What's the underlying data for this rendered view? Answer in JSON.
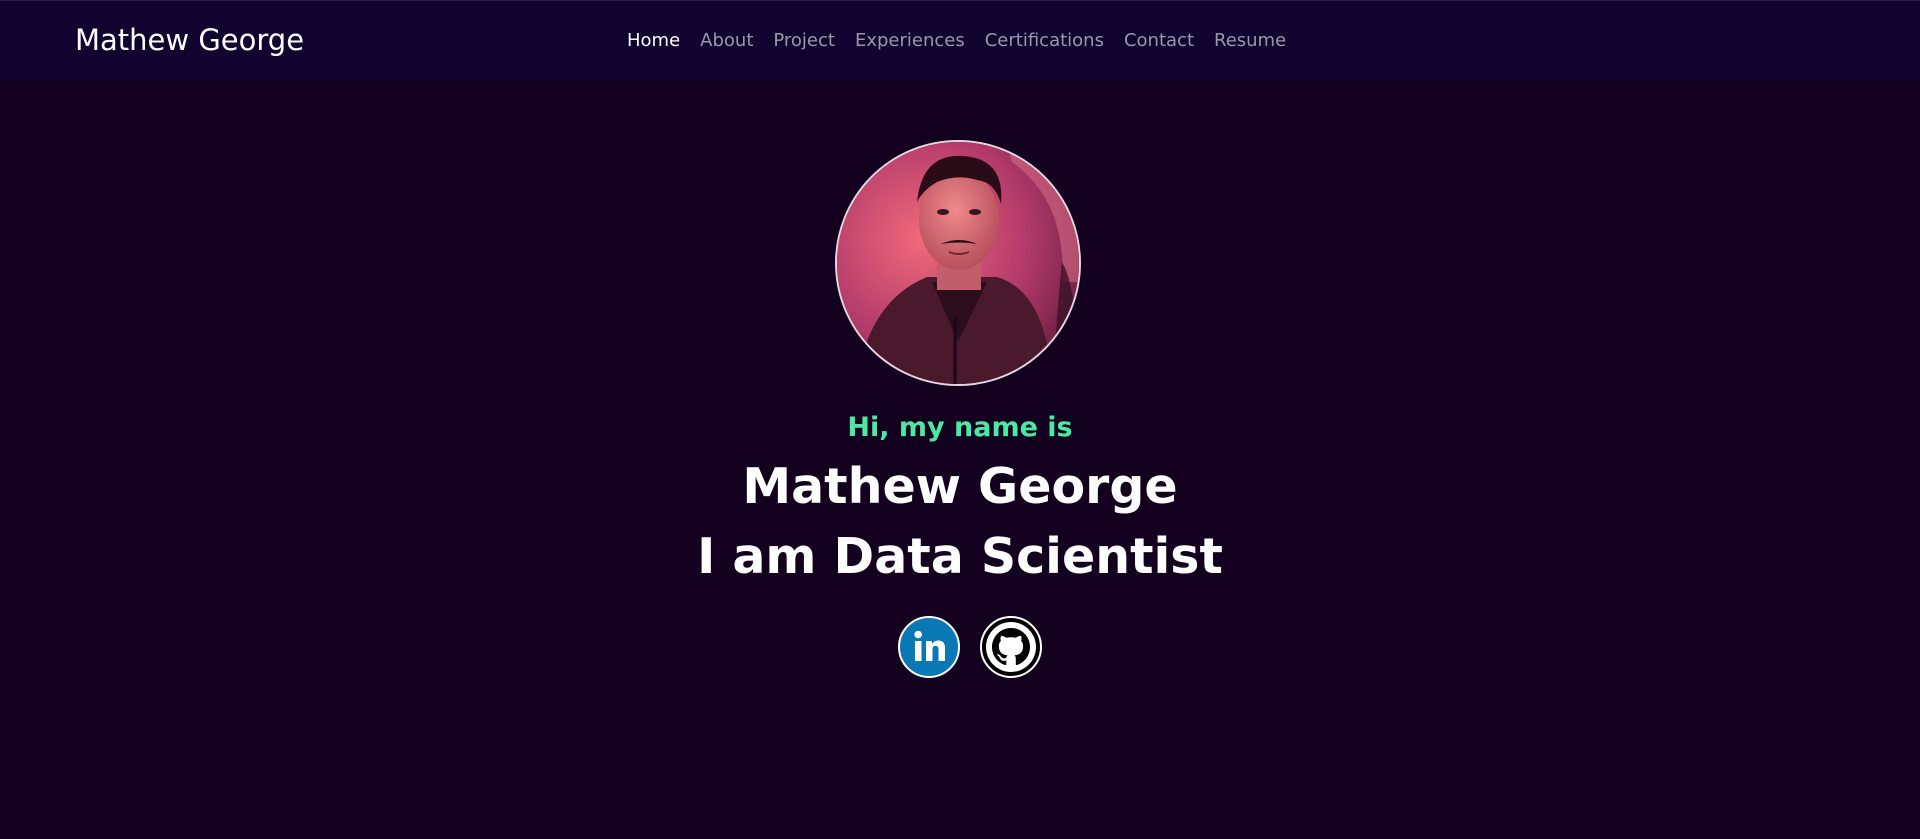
{
  "navbar": {
    "brand": "Mathew George",
    "links": [
      {
        "label": "Home",
        "active": true
      },
      {
        "label": "About"
      },
      {
        "label": "Project"
      },
      {
        "label": "Experiences"
      },
      {
        "label": "Certifications"
      },
      {
        "label": "Contact"
      },
      {
        "label": "Resume"
      }
    ]
  },
  "hero": {
    "greeting": "Hi, my name is",
    "name": "Mathew George",
    "role": "I am Data Scientist",
    "avatar_icon": "profile-photo",
    "social": [
      {
        "icon": "linkedin-icon",
        "color": "#0a78b5"
      },
      {
        "icon": "github-icon",
        "color": "#000000"
      }
    ]
  },
  "colors": {
    "background": "#13001f",
    "navbar": "#120230",
    "accent": "#4ee8a6",
    "nav_inactive": "#9b98a6"
  }
}
